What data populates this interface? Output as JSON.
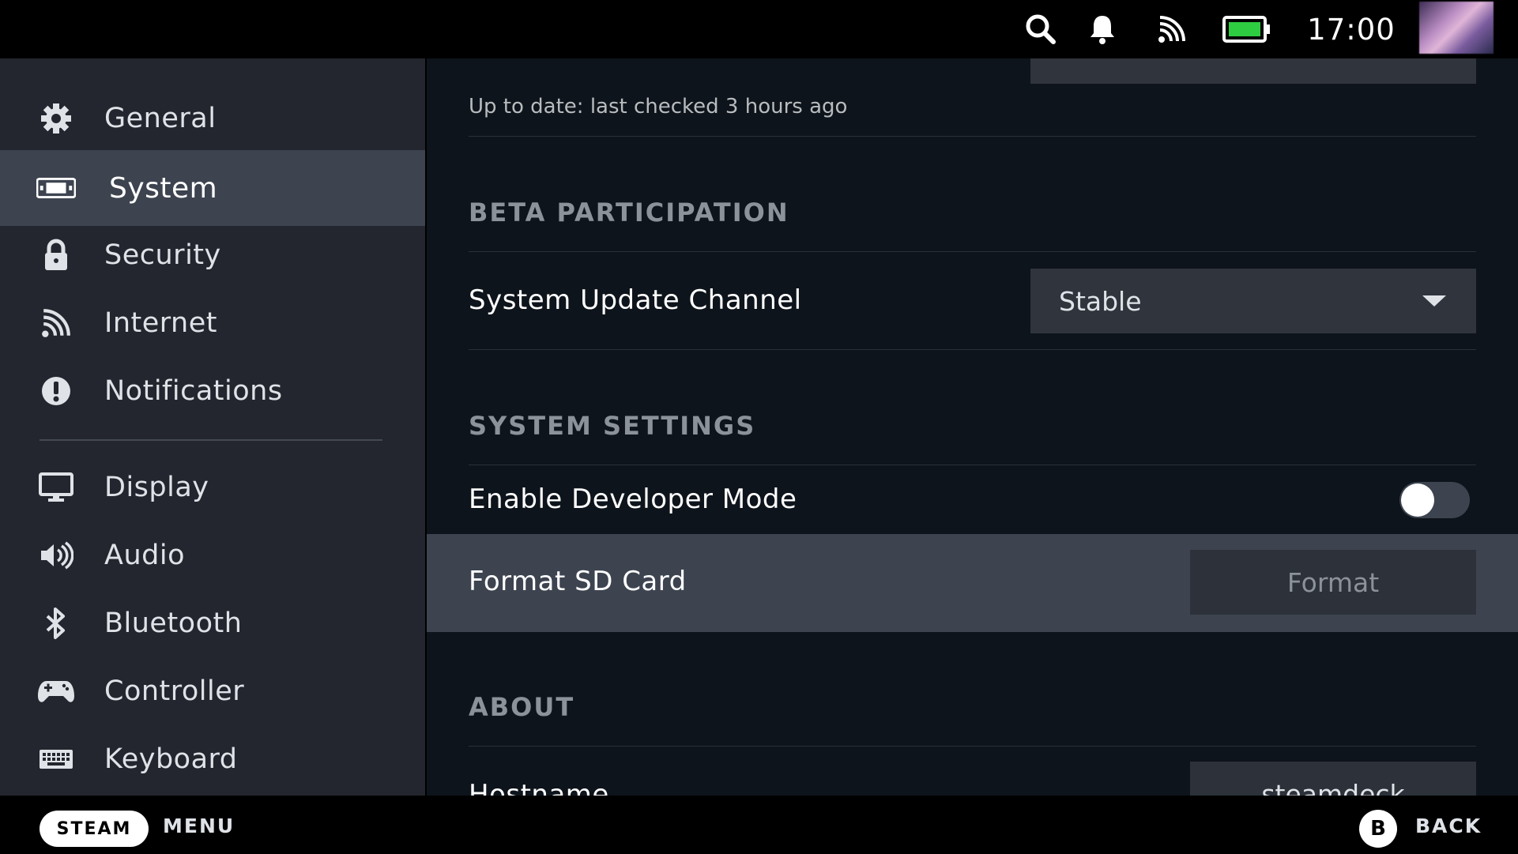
{
  "topbar": {
    "clock": "17:00",
    "icons": [
      "search-icon",
      "bell-icon",
      "wifi-icon",
      "battery-icon"
    ],
    "battery_color": "#2ecc40"
  },
  "sidebar": {
    "items": [
      {
        "label": "General",
        "icon": "gear-icon"
      },
      {
        "label": "System",
        "icon": "system-icon",
        "active": true
      },
      {
        "label": "Security",
        "icon": "lock-icon"
      },
      {
        "label": "Internet",
        "icon": "wifi-icon"
      },
      {
        "label": "Notifications",
        "icon": "alert-icon"
      },
      {
        "label": "Display",
        "icon": "monitor-icon"
      },
      {
        "label": "Audio",
        "icon": "speaker-icon"
      },
      {
        "label": "Bluetooth",
        "icon": "bluetooth-icon"
      },
      {
        "label": "Controller",
        "icon": "gamepad-icon"
      },
      {
        "label": "Keyboard",
        "icon": "keyboard-icon"
      }
    ]
  },
  "main": {
    "update_status": "Up to date: last checked 3 hours ago",
    "beta": {
      "heading": "BETA PARTICIPATION",
      "channel_label": "System Update Channel",
      "channel_value": "Stable"
    },
    "system_settings": {
      "heading": "SYSTEM SETTINGS",
      "dev_mode_label": "Enable Developer Mode",
      "dev_mode_on": false,
      "format_label": "Format SD Card",
      "format_button": "Format"
    },
    "about": {
      "heading": "ABOUT",
      "hostname_label": "Hostname",
      "hostname_value": "steamdeck"
    }
  },
  "bottombar": {
    "steam_label": "STEAM",
    "menu_label": "MENU",
    "b_label": "B",
    "back_label": "BACK"
  },
  "colors": {
    "sidebar_bg": "#23262e",
    "active_bg": "#3d4450",
    "main_bg": "#0e141b"
  }
}
